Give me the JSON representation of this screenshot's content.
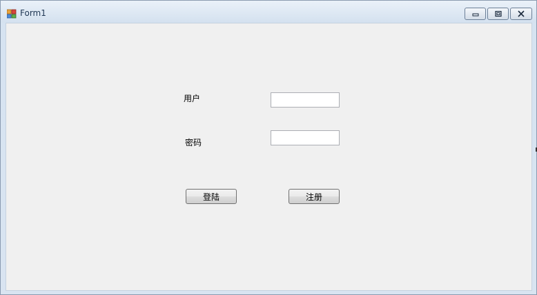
{
  "window": {
    "title": "Form1"
  },
  "form": {
    "username_label": "用户",
    "password_label": "密码",
    "username_value": "",
    "password_value": "",
    "login_button": "登陆",
    "register_button": "注册"
  }
}
